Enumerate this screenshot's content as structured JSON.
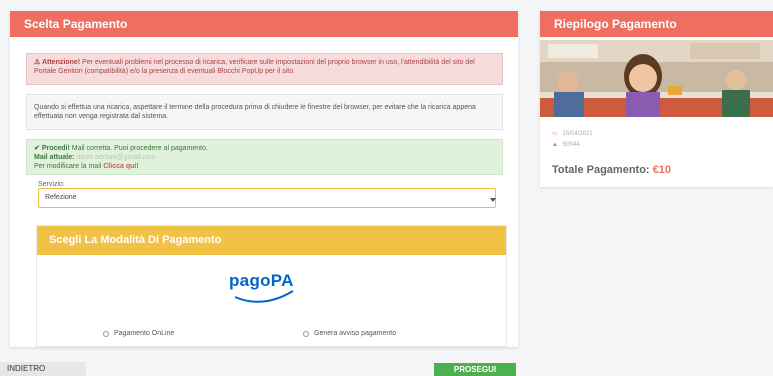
{
  "payment_choice": {
    "title": "Scelta Pagamento",
    "warning": {
      "strong": "Attenzione!",
      "text": " Per eventuali problemi nel processo di ricarica, verificare sulle impostazioni del proprio browser in uso, l'attendibilità del sito del Portale Genitori (compatibilità) e/o la presenza di eventuali Blocchi PopUp per il sito."
    },
    "info": "Quando si effettua una ricarica, aspettare il termine della procedura prima di chiudere le finestre del browser, per evitare che la ricarica appena effettuata non venga registrata dal sistema.",
    "success": {
      "strong": "Procedi!",
      "text": " Mail corretta. Puoi procedere al pagamento.",
      "mail_label": "Mail attuale:",
      "mail_value": "denis.bertoni@gmail.com",
      "modify_text": "Per modificare la mail ",
      "modify_link": "Clicca qui!"
    },
    "servizio_label": "Servizio:",
    "servizio_value": "Refezione"
  },
  "payment_mode": {
    "title": "Scegli La Modalità Di Pagamento",
    "logo_text": "pagoPA",
    "options": [
      "Pagamento OnLine",
      "Genera avviso pagamento"
    ]
  },
  "summary": {
    "title": "Riepilogo Pagamento",
    "date": "15/04/2021",
    "code": "50044",
    "total_label": "Totale Pagamento: ",
    "total_amount": "€10"
  },
  "buttons": {
    "back": "INDIETRO",
    "next": "PROSEGUI"
  },
  "colors": {
    "header_red": "#ee6f5f",
    "payment_yellow": "#f2c247",
    "next_green": "#4caf50"
  }
}
